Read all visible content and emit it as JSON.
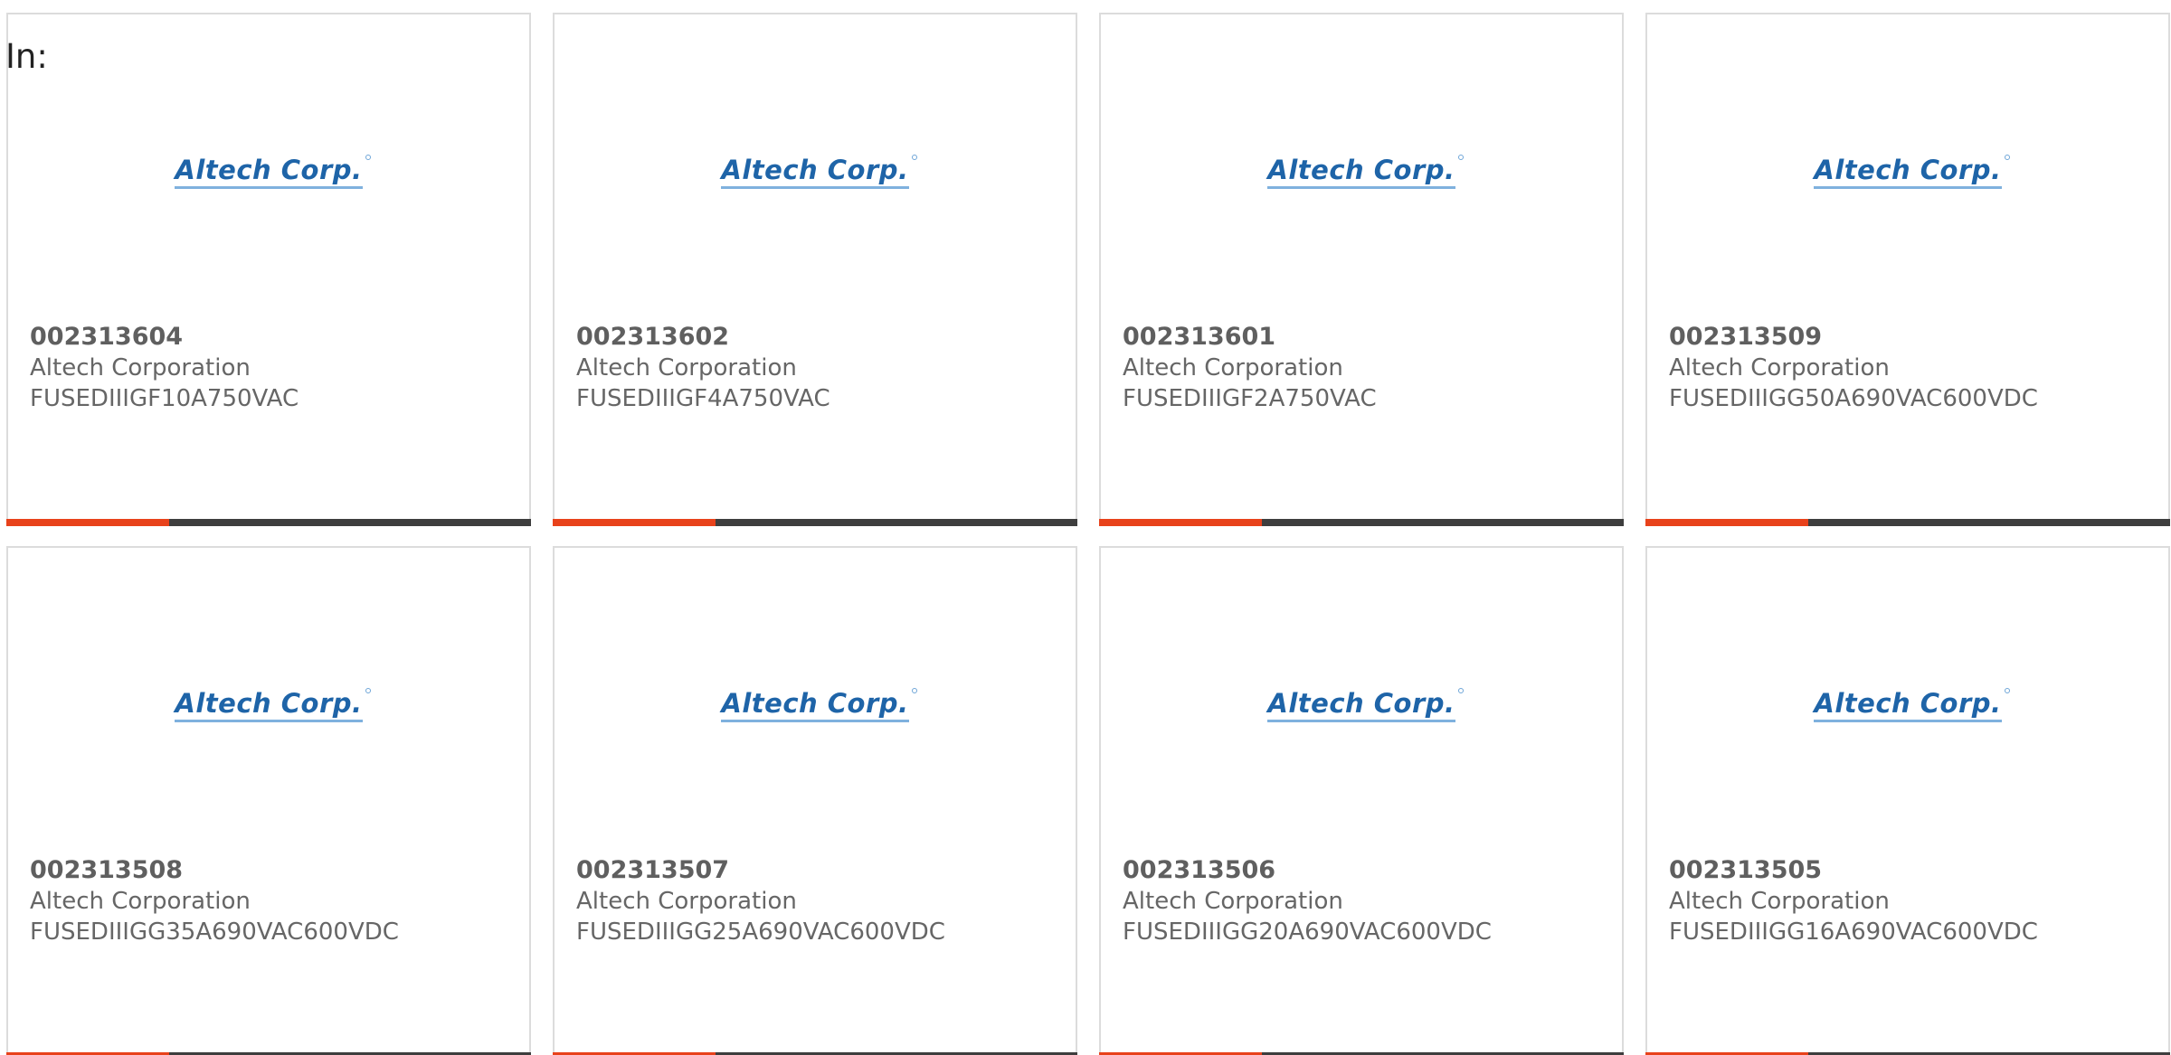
{
  "filter": {
    "label": "In:"
  },
  "brand": {
    "logo_text": "Altech Corp.",
    "accent_color": "#e8421b",
    "bar_color": "#3e3e3e",
    "logo_color": "#1e64a8"
  },
  "accent_fraction": 0.31,
  "products": [
    {
      "part_number": "002313604",
      "manufacturer": "Altech Corporation",
      "description": "FUSEDIIIGF10A750VAC"
    },
    {
      "part_number": "002313602",
      "manufacturer": "Altech Corporation",
      "description": "FUSEDIIIGF4A750VAC"
    },
    {
      "part_number": "002313601",
      "manufacturer": "Altech Corporation",
      "description": "FUSEDIIIGF2A750VAC"
    },
    {
      "part_number": "002313509",
      "manufacturer": "Altech Corporation",
      "description": "FUSEDIIIGG50A690VAC600VDC"
    },
    {
      "part_number": "002313508",
      "manufacturer": "Altech Corporation",
      "description": "FUSEDIIIGG35A690VAC600VDC"
    },
    {
      "part_number": "002313507",
      "manufacturer": "Altech Corporation",
      "description": "FUSEDIIIGG25A690VAC600VDC"
    },
    {
      "part_number": "002313506",
      "manufacturer": "Altech Corporation",
      "description": "FUSEDIIIGG20A690VAC600VDC"
    },
    {
      "part_number": "002313505",
      "manufacturer": "Altech Corporation",
      "description": "FUSEDIIIGG16A690VAC600VDC"
    }
  ]
}
